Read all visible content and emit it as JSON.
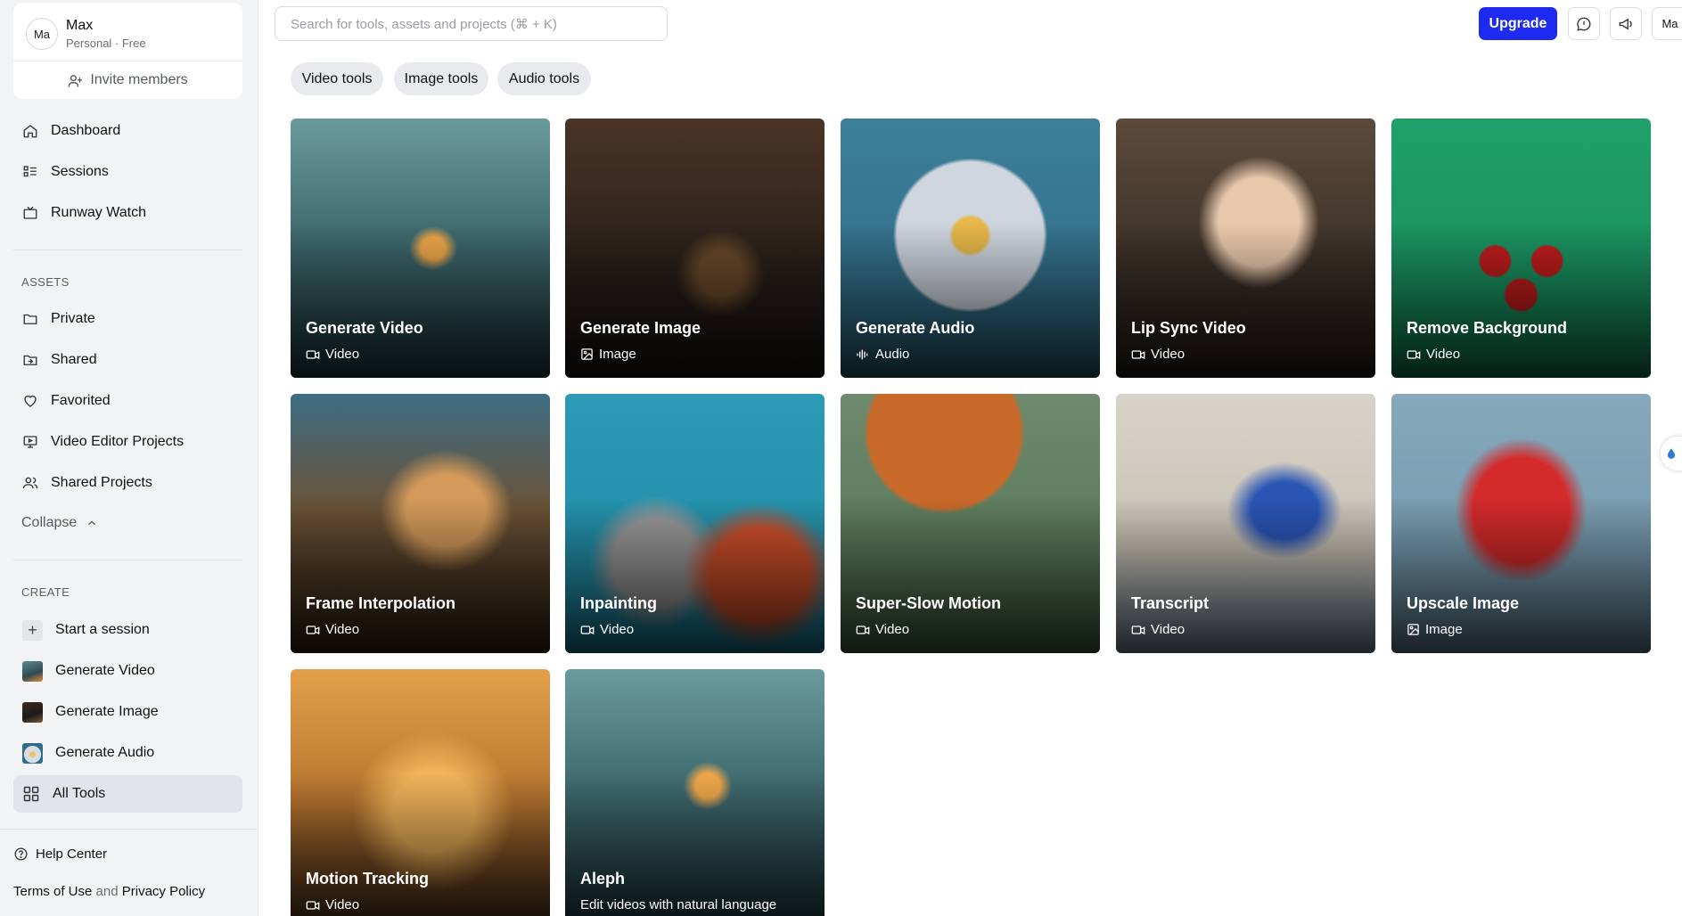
{
  "account": {
    "avatar_initials": "Ma",
    "name": "Max",
    "plan": "Personal · Free",
    "invite_label": "Invite members"
  },
  "nav_main": [
    {
      "label": "Dashboard",
      "icon": "home-icon"
    },
    {
      "label": "Sessions",
      "icon": "list-icon"
    },
    {
      "label": "Runway Watch",
      "icon": "tv-icon"
    }
  ],
  "assets": {
    "label": "ASSETS",
    "items": [
      {
        "label": "Private",
        "icon": "folder-icon"
      },
      {
        "label": "Shared",
        "icon": "shared-folder-icon"
      },
      {
        "label": "Favorited",
        "icon": "heart-icon"
      },
      {
        "label": "Video Editor Projects",
        "icon": "monitor-icon"
      },
      {
        "label": "Shared Projects",
        "icon": "users-icon"
      }
    ],
    "collapse_label": "Collapse"
  },
  "create": {
    "label": "CREATE",
    "items": [
      {
        "label": "Start a session",
        "icon": "plus-icon"
      },
      {
        "label": "Generate Video",
        "icon": "video-thumb"
      },
      {
        "label": "Generate Image",
        "icon": "image-thumb"
      },
      {
        "label": "Generate Audio",
        "icon": "audio-thumb"
      },
      {
        "label": "All Tools",
        "icon": "grid-icon",
        "active": true
      }
    ]
  },
  "footer": {
    "help": "Help Center",
    "terms": "Terms of Use",
    "and": "and",
    "privacy": "Privacy Policy"
  },
  "search": {
    "placeholder": "Search for tools, assets and projects (⌘ + K)"
  },
  "topbar": {
    "upgrade": "Upgrade",
    "user_initials": "Ma"
  },
  "filters": [
    "Video tools",
    "Image tools",
    "Audio tools"
  ],
  "tools": [
    {
      "title": "Generate Video",
      "sub": "Video",
      "kind": "video"
    },
    {
      "title": "Generate Image",
      "sub": "Image",
      "kind": "image"
    },
    {
      "title": "Generate Audio",
      "sub": "Audio",
      "kind": "audio"
    },
    {
      "title": "Lip Sync Video",
      "sub": "Video",
      "kind": "video"
    },
    {
      "title": "Remove Background",
      "sub": "Video",
      "kind": "video"
    },
    {
      "title": "Frame Interpolation",
      "sub": "Video",
      "kind": "video"
    },
    {
      "title": "Inpainting",
      "sub": "Video",
      "kind": "video"
    },
    {
      "title": "Super-Slow Motion",
      "sub": "Video",
      "kind": "video"
    },
    {
      "title": "Transcript",
      "sub": "Video",
      "kind": "video"
    },
    {
      "title": "Upscale Image",
      "sub": "Image",
      "kind": "image"
    },
    {
      "title": "Motion Tracking",
      "sub": "Video",
      "kind": "video"
    },
    {
      "title": "Aleph",
      "sub": "Edit videos with natural language",
      "kind": "none"
    }
  ],
  "colors": {
    "accent": "#1d2bf0",
    "sidebar_bg": "#f2f3f5",
    "chip_bg": "#e9eaee"
  }
}
